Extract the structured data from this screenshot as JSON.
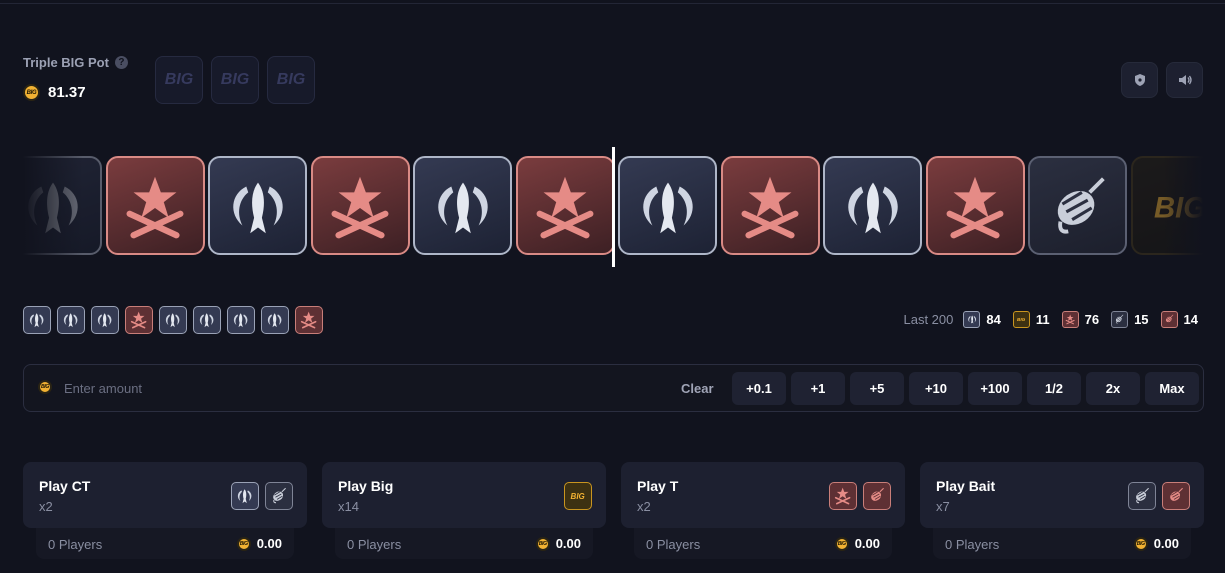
{
  "pot": {
    "title": "Triple BIG Pot",
    "help_glyph": "?",
    "amount": "81.37",
    "slot_labels": [
      "BIG",
      "BIG",
      "BIG"
    ]
  },
  "header_buttons": [
    "shield-icon",
    "speaker-icon"
  ],
  "coin_label": "BIG",
  "strip": [
    {
      "type": "ct",
      "dim": true
    },
    {
      "type": "t"
    },
    {
      "type": "ct"
    },
    {
      "type": "t"
    },
    {
      "type": "ct"
    },
    {
      "type": "t"
    },
    {
      "type": "ct"
    },
    {
      "type": "t"
    },
    {
      "type": "ct"
    },
    {
      "type": "t"
    },
    {
      "type": "bait"
    },
    {
      "type": "big",
      "dim": true
    }
  ],
  "history": [
    "ct",
    "ct",
    "ct",
    "t",
    "ct",
    "ct",
    "ct",
    "ct",
    "t"
  ],
  "last200": {
    "label": "Last 200",
    "items": [
      {
        "type": "ct",
        "count": "84"
      },
      {
        "type": "big",
        "count": "11"
      },
      {
        "type": "t",
        "count": "76"
      },
      {
        "type": "bait",
        "count": "15"
      },
      {
        "type": "t-bait",
        "count": "14"
      }
    ]
  },
  "bet": {
    "placeholder": "Enter amount",
    "clear_label": "Clear",
    "quick_buttons": [
      "+0.1",
      "+1",
      "+5",
      "+10",
      "+100",
      "1/2",
      "2x",
      "Max"
    ]
  },
  "cards": [
    {
      "title": "Play CT",
      "mult": "x2",
      "icons": [
        "ct",
        "bait"
      ],
      "players": "0 Players",
      "total": "0.00"
    },
    {
      "title": "Play Big",
      "mult": "x14",
      "icons": [
        "big"
      ],
      "players": "0 Players",
      "total": "0.00"
    },
    {
      "title": "Play T",
      "mult": "x2",
      "icons": [
        "t",
        "t-bait"
      ],
      "players": "0 Players",
      "total": "0.00"
    },
    {
      "title": "Play Bait",
      "mult": "x7",
      "icons": [
        "bait",
        "t-bait"
      ],
      "players": "0 Players",
      "total": "0.00"
    }
  ],
  "colors": {
    "background": "#11131e",
    "ct": "#aeb6c8",
    "t": "#d98a85",
    "big": "#f2b233"
  }
}
